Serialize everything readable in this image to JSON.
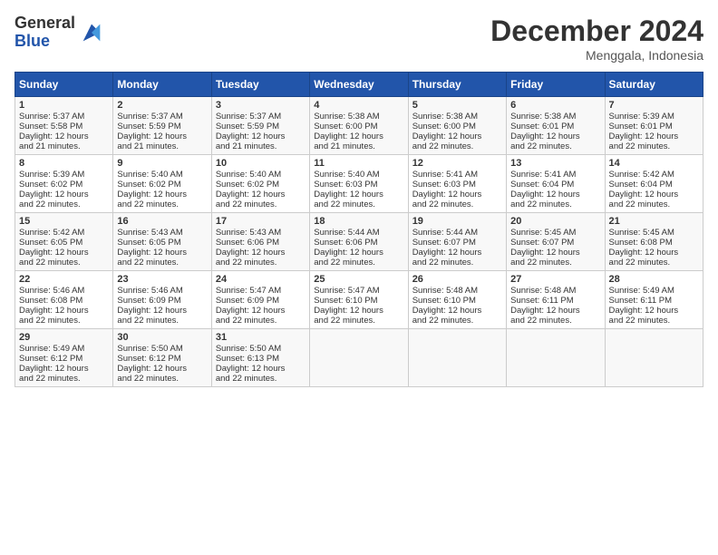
{
  "header": {
    "logo_line1": "General",
    "logo_line2": "Blue",
    "title": "December 2024",
    "subtitle": "Menggala, Indonesia"
  },
  "days_of_week": [
    "Sunday",
    "Monday",
    "Tuesday",
    "Wednesday",
    "Thursday",
    "Friday",
    "Saturday"
  ],
  "weeks": [
    [
      {
        "day": "1",
        "info": "Sunrise: 5:37 AM\nSunset: 5:58 PM\nDaylight: 12 hours\nand 21 minutes."
      },
      {
        "day": "2",
        "info": "Sunrise: 5:37 AM\nSunset: 5:59 PM\nDaylight: 12 hours\nand 21 minutes."
      },
      {
        "day": "3",
        "info": "Sunrise: 5:37 AM\nSunset: 5:59 PM\nDaylight: 12 hours\nand 21 minutes."
      },
      {
        "day": "4",
        "info": "Sunrise: 5:38 AM\nSunset: 6:00 PM\nDaylight: 12 hours\nand 21 minutes."
      },
      {
        "day": "5",
        "info": "Sunrise: 5:38 AM\nSunset: 6:00 PM\nDaylight: 12 hours\nand 22 minutes."
      },
      {
        "day": "6",
        "info": "Sunrise: 5:38 AM\nSunset: 6:01 PM\nDaylight: 12 hours\nand 22 minutes."
      },
      {
        "day": "7",
        "info": "Sunrise: 5:39 AM\nSunset: 6:01 PM\nDaylight: 12 hours\nand 22 minutes."
      }
    ],
    [
      {
        "day": "8",
        "info": "Sunrise: 5:39 AM\nSunset: 6:02 PM\nDaylight: 12 hours\nand 22 minutes."
      },
      {
        "day": "9",
        "info": "Sunrise: 5:40 AM\nSunset: 6:02 PM\nDaylight: 12 hours\nand 22 minutes."
      },
      {
        "day": "10",
        "info": "Sunrise: 5:40 AM\nSunset: 6:02 PM\nDaylight: 12 hours\nand 22 minutes."
      },
      {
        "day": "11",
        "info": "Sunrise: 5:40 AM\nSunset: 6:03 PM\nDaylight: 12 hours\nand 22 minutes."
      },
      {
        "day": "12",
        "info": "Sunrise: 5:41 AM\nSunset: 6:03 PM\nDaylight: 12 hours\nand 22 minutes."
      },
      {
        "day": "13",
        "info": "Sunrise: 5:41 AM\nSunset: 6:04 PM\nDaylight: 12 hours\nand 22 minutes."
      },
      {
        "day": "14",
        "info": "Sunrise: 5:42 AM\nSunset: 6:04 PM\nDaylight: 12 hours\nand 22 minutes."
      }
    ],
    [
      {
        "day": "15",
        "info": "Sunrise: 5:42 AM\nSunset: 6:05 PM\nDaylight: 12 hours\nand 22 minutes."
      },
      {
        "day": "16",
        "info": "Sunrise: 5:43 AM\nSunset: 6:05 PM\nDaylight: 12 hours\nand 22 minutes."
      },
      {
        "day": "17",
        "info": "Sunrise: 5:43 AM\nSunset: 6:06 PM\nDaylight: 12 hours\nand 22 minutes."
      },
      {
        "day": "18",
        "info": "Sunrise: 5:44 AM\nSunset: 6:06 PM\nDaylight: 12 hours\nand 22 minutes."
      },
      {
        "day": "19",
        "info": "Sunrise: 5:44 AM\nSunset: 6:07 PM\nDaylight: 12 hours\nand 22 minutes."
      },
      {
        "day": "20",
        "info": "Sunrise: 5:45 AM\nSunset: 6:07 PM\nDaylight: 12 hours\nand 22 minutes."
      },
      {
        "day": "21",
        "info": "Sunrise: 5:45 AM\nSunset: 6:08 PM\nDaylight: 12 hours\nand 22 minutes."
      }
    ],
    [
      {
        "day": "22",
        "info": "Sunrise: 5:46 AM\nSunset: 6:08 PM\nDaylight: 12 hours\nand 22 minutes."
      },
      {
        "day": "23",
        "info": "Sunrise: 5:46 AM\nSunset: 6:09 PM\nDaylight: 12 hours\nand 22 minutes."
      },
      {
        "day": "24",
        "info": "Sunrise: 5:47 AM\nSunset: 6:09 PM\nDaylight: 12 hours\nand 22 minutes."
      },
      {
        "day": "25",
        "info": "Sunrise: 5:47 AM\nSunset: 6:10 PM\nDaylight: 12 hours\nand 22 minutes."
      },
      {
        "day": "26",
        "info": "Sunrise: 5:48 AM\nSunset: 6:10 PM\nDaylight: 12 hours\nand 22 minutes."
      },
      {
        "day": "27",
        "info": "Sunrise: 5:48 AM\nSunset: 6:11 PM\nDaylight: 12 hours\nand 22 minutes."
      },
      {
        "day": "28",
        "info": "Sunrise: 5:49 AM\nSunset: 6:11 PM\nDaylight: 12 hours\nand 22 minutes."
      }
    ],
    [
      {
        "day": "29",
        "info": "Sunrise: 5:49 AM\nSunset: 6:12 PM\nDaylight: 12 hours\nand 22 minutes."
      },
      {
        "day": "30",
        "info": "Sunrise: 5:50 AM\nSunset: 6:12 PM\nDaylight: 12 hours\nand 22 minutes."
      },
      {
        "day": "31",
        "info": "Sunrise: 5:50 AM\nSunset: 6:13 PM\nDaylight: 12 hours\nand 22 minutes."
      },
      {
        "day": "",
        "info": ""
      },
      {
        "day": "",
        "info": ""
      },
      {
        "day": "",
        "info": ""
      },
      {
        "day": "",
        "info": ""
      }
    ]
  ]
}
